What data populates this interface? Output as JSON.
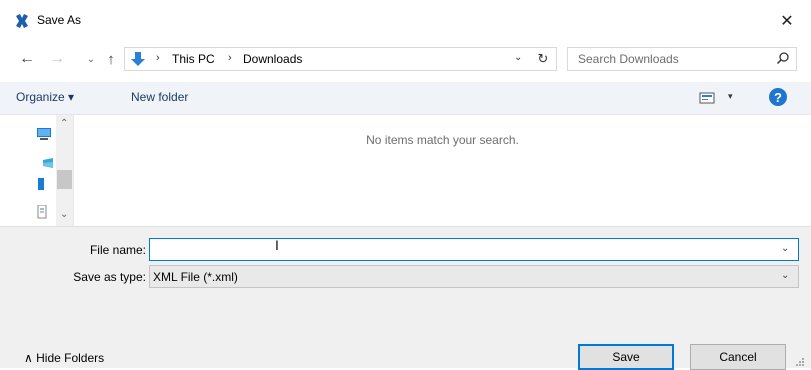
{
  "window": {
    "title": "Save As",
    "close_glyph": "✕"
  },
  "nav": {
    "back_glyph": "←",
    "forward_glyph": "→",
    "recent_glyph": "⌄",
    "up_glyph": "↑",
    "breadcrumb": [
      "This PC",
      "Downloads"
    ],
    "breadcrumb_sep": "›",
    "address_dropdown_glyph": "⌄",
    "refresh_glyph": "↻",
    "search_placeholder": "Search Downloads"
  },
  "toolbar": {
    "organize_label": "Organize ▾",
    "new_folder_label": "New folder",
    "view_dropdown_glyph": "▾",
    "help_glyph": "?"
  },
  "navpane": {
    "scroll_up_glyph": "⌃",
    "scroll_down_glyph": "⌄",
    "items": [
      "computer-icon",
      "cloud-icon",
      "blue-folder-icon",
      "document-icon"
    ]
  },
  "filelist": {
    "empty_message": "No items match your search."
  },
  "form": {
    "file_name_label": "File name:",
    "file_name_value": "",
    "save_as_type_label": "Save as type:",
    "save_as_type_value": "XML File (*.xml)",
    "dropdown_glyph": "⌄",
    "cursor_glyph": "I"
  },
  "footer": {
    "hide_folders_label": "∧  Hide Folders",
    "save_label": "Save",
    "cancel_label": "Cancel"
  },
  "colors": {
    "accent": "#0078d7",
    "command_bar_bg": "#f0f4f9",
    "panel_bg": "#f0f0f0",
    "link_text": "#1e3966"
  }
}
